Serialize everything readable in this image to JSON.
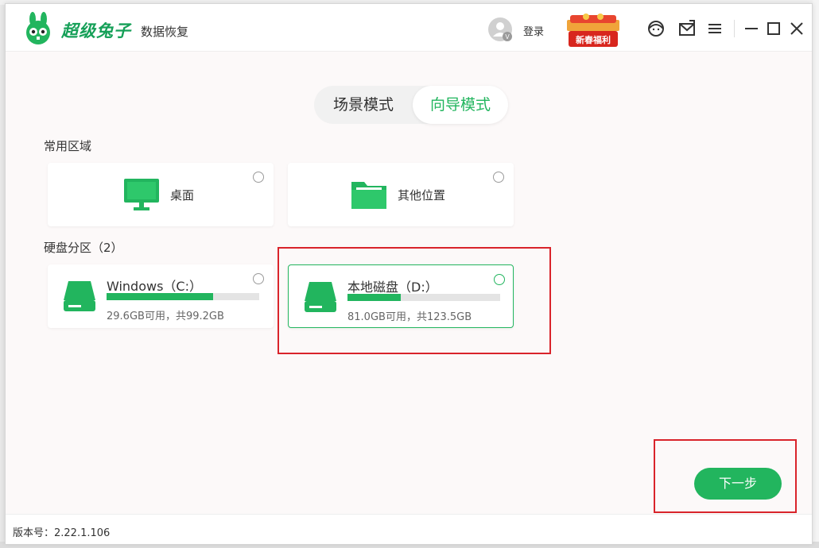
{
  "app": {
    "brand": "超级兔子",
    "brand_sub": "数据恢复",
    "login": "登录",
    "promo": "新春福利",
    "avatar_letter": "V"
  },
  "icons": {
    "logo": "rabbit-logo-icon",
    "user": "user-avatar-icon",
    "support": "customer-service-icon",
    "feedback": "feedback-mail-icon",
    "menu": "menu-icon",
    "minimize": "minimize-icon",
    "maximize": "maximize-icon",
    "close": "close-icon",
    "desktop": "monitor-icon",
    "folder": "folder-icon",
    "disk": "hard-drive-icon"
  },
  "colors": {
    "accent": "#22b55e",
    "highlight": "#d9242b"
  },
  "modes": {
    "scene": "场景模式",
    "wizard": "向导模式",
    "active": "向导模式"
  },
  "common": {
    "title": "常用区域",
    "items": [
      {
        "label": "桌面"
      },
      {
        "label": "其他位置"
      }
    ]
  },
  "disks": {
    "title": "硬盘分区（2）",
    "items": [
      {
        "label": "Windows（C:）",
        "info": "29.6GB可用，共99.2GB",
        "used_fraction": 0.7,
        "selected": false
      },
      {
        "label": "本地磁盘（D:）",
        "info": "81.0GB可用，共123.5GB",
        "used_fraction": 0.35,
        "selected": true
      }
    ]
  },
  "actions": {
    "next": "下一步"
  },
  "footer": {
    "version": "版本号：2.22.1.106"
  }
}
